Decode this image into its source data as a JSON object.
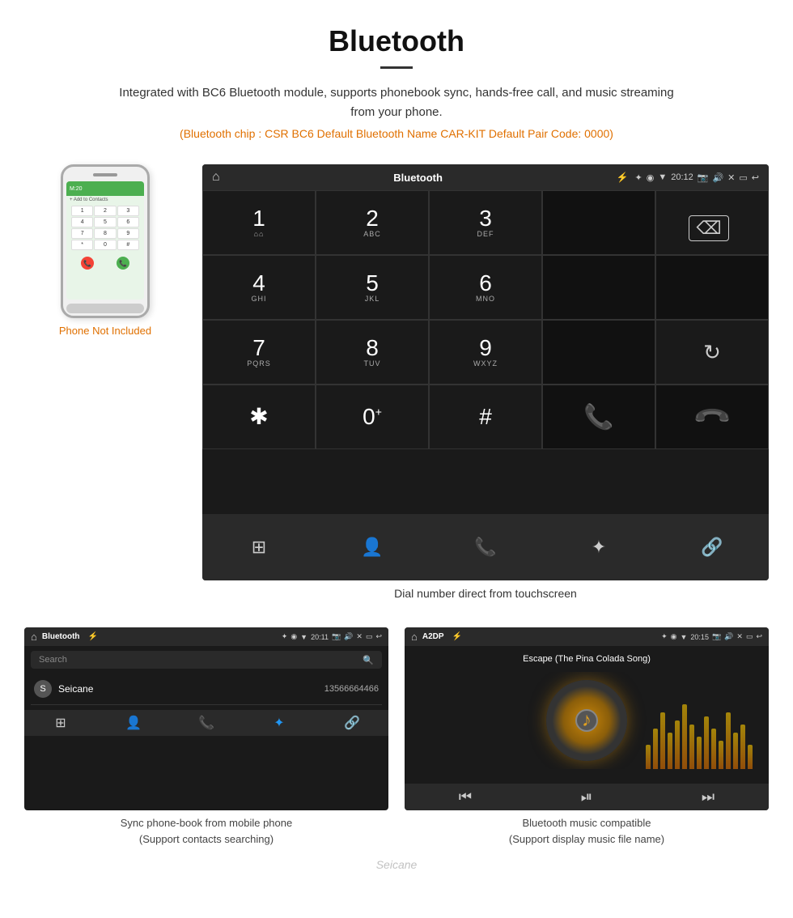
{
  "header": {
    "title": "Bluetooth",
    "description": "Integrated with BC6 Bluetooth module, supports phonebook sync, hands-free call, and music streaming from your phone.",
    "specs": "(Bluetooth chip : CSR BC6    Default Bluetooth Name CAR-KIT    Default Pair Code: 0000)"
  },
  "phone": {
    "not_included_label": "Phone Not Included"
  },
  "dialpad_screen": {
    "status_bar": {
      "home_icon": "⌂",
      "title": "Bluetooth",
      "usb_icon": "⚡",
      "bluetooth_icon": "✦",
      "location_icon": "◉",
      "signal_icon": "▼",
      "time": "20:12",
      "camera_icon": "📷",
      "volume_icon": "🔊",
      "close_icon": "✕",
      "window_icon": "▭",
      "back_icon": "↩"
    },
    "keys": [
      {
        "num": "1",
        "sub": "⌂⌂"
      },
      {
        "num": "2",
        "sub": "ABC"
      },
      {
        "num": "3",
        "sub": "DEF"
      },
      {
        "num": "",
        "sub": ""
      },
      {
        "num": "⌫",
        "sub": ""
      },
      {
        "num": "4",
        "sub": "GHI"
      },
      {
        "num": "5",
        "sub": "JKL"
      },
      {
        "num": "6",
        "sub": "MNO"
      },
      {
        "num": "",
        "sub": ""
      },
      {
        "num": "",
        "sub": ""
      },
      {
        "num": "7",
        "sub": "PQRS"
      },
      {
        "num": "8",
        "sub": "TUV"
      },
      {
        "num": "9",
        "sub": "WXYZ"
      },
      {
        "num": "",
        "sub": ""
      },
      {
        "num": "↻",
        "sub": ""
      },
      {
        "num": "✱",
        "sub": ""
      },
      {
        "num": "0⁺",
        "sub": ""
      },
      {
        "num": "#",
        "sub": ""
      },
      {
        "num": "📞",
        "sub": ""
      },
      {
        "num": "📞",
        "sub": ""
      }
    ],
    "toolbar": {
      "grid_icon": "⊞",
      "contact_icon": "👤",
      "phone_icon": "📞",
      "bluetooth_icon": "⚡",
      "link_icon": "🔗"
    },
    "caption": "Dial number direct from touchscreen"
  },
  "phonebook_screen": {
    "status_bar": {
      "title": "Bluetooth",
      "time": "20:11"
    },
    "search_placeholder": "Search",
    "contacts": [
      {
        "initial": "S",
        "name": "Seicane",
        "number": "13566664466"
      }
    ],
    "toolbar": {
      "grid": "⊞",
      "contact": "👤",
      "phone": "📞",
      "bluetooth": "✦",
      "link": "🔗"
    },
    "caption_line1": "Sync phone-book from mobile phone",
    "caption_line2": "(Support contacts searching)"
  },
  "music_screen": {
    "status_bar": {
      "title": "A2DP",
      "time": "20:15"
    },
    "song_title": "Escape (The Pina Colada Song)",
    "eq_bars": [
      30,
      50,
      70,
      45,
      60,
      80,
      55,
      40,
      65,
      50,
      35,
      70,
      45,
      55,
      30
    ],
    "toolbar": {
      "prev": "⏮",
      "play_pause": "⏯",
      "next": "⏭"
    },
    "caption_line1": "Bluetooth music compatible",
    "caption_line2": "(Support display music file name)"
  },
  "watermark": "Seicane"
}
